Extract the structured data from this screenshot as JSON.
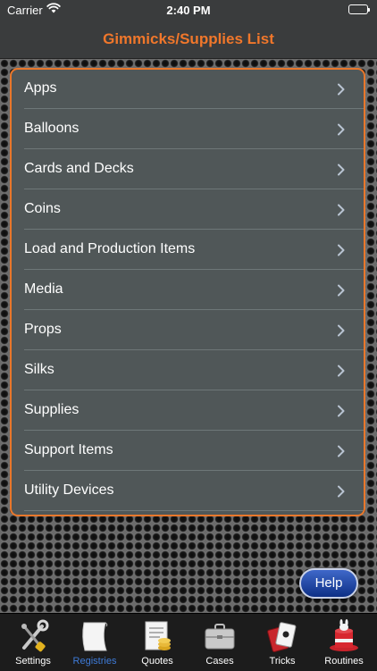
{
  "status_bar": {
    "carrier": "Carrier",
    "time": "2:40 PM"
  },
  "nav": {
    "title": "Gimmicks/Supplies List"
  },
  "list": {
    "items": [
      {
        "label": "Apps"
      },
      {
        "label": "Balloons"
      },
      {
        "label": "Cards and Decks"
      },
      {
        "label": "Coins"
      },
      {
        "label": "Load and Production Items"
      },
      {
        "label": "Media"
      },
      {
        "label": "Props"
      },
      {
        "label": "Silks"
      },
      {
        "label": "Supplies"
      },
      {
        "label": "Support Items"
      },
      {
        "label": "Utility Devices"
      }
    ]
  },
  "help_button": {
    "label": "Help"
  },
  "tab_bar": {
    "active_tab": "Registries",
    "tabs": [
      {
        "label": "Settings",
        "icon": "tools-icon"
      },
      {
        "label": "Registries",
        "icon": "paper-icon"
      },
      {
        "label": "Quotes",
        "icon": "invoice-coins-icon"
      },
      {
        "label": "Cases",
        "icon": "briefcase-icon"
      },
      {
        "label": "Tricks",
        "icon": "playing-cards-icon"
      },
      {
        "label": "Routines",
        "icon": "magic-hat-icon"
      }
    ]
  },
  "colors": {
    "accent_orange": "#f0772b",
    "active_tab_blue": "#3e7bd8",
    "list_background": "#505758"
  }
}
